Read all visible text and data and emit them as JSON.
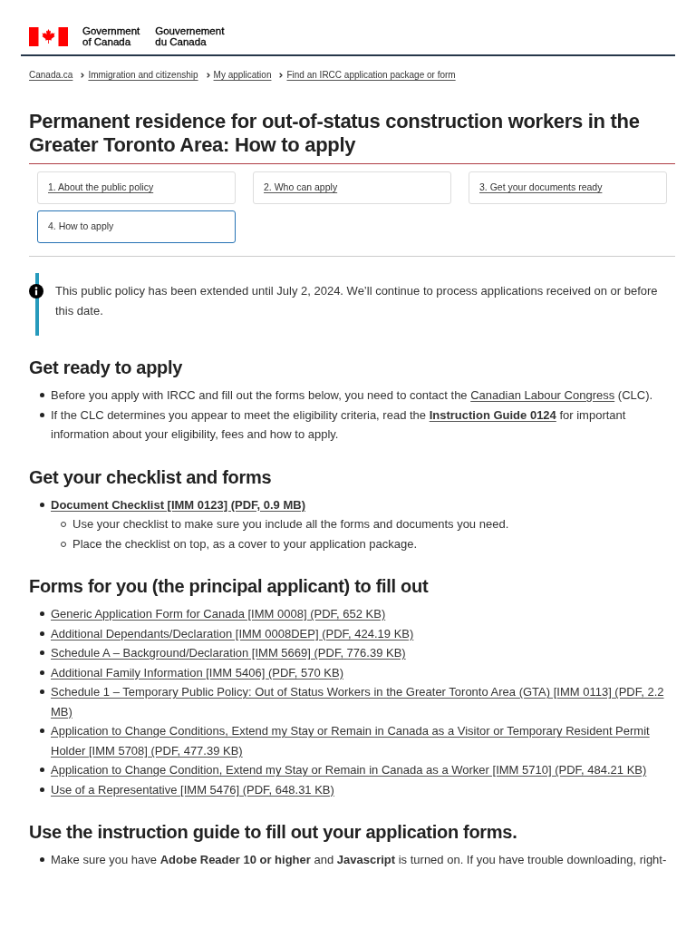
{
  "header": {
    "wordmark_en": [
      "Government",
      "of Canada"
    ],
    "wordmark_fr": [
      "Gouvernement",
      "du Canada"
    ]
  },
  "breadcrumbs": [
    "Canada.ca",
    "Immigration and citizenship",
    "My application",
    "Find an IRCC application package or form"
  ],
  "title": "Permanent residence for out-of-status construction workers in the Greater Toronto Area: How to apply",
  "steps": [
    {
      "label": "1. About the public policy",
      "selected": false
    },
    {
      "label": "2. Who can apply",
      "selected": false
    },
    {
      "label": "3. Get your documents ready",
      "selected": false
    },
    {
      "label": "4. How to apply",
      "selected": true
    }
  ],
  "notice": {
    "text": "This public policy has been extended until July 2, 2024. We’ll continue to process applications received on or before this date."
  },
  "sections": [
    {
      "heading": "Get ready to apply",
      "items": [
        {
          "kind": "paragraph",
          "parts": [
            {
              "kind": "text",
              "text": "Before you apply with IRCC and fill out the forms below, you need to contact the "
            },
            {
              "kind": "link",
              "text": "Canadian Labour Congress",
              "bold": false
            },
            {
              "kind": "text",
              "text": " (CLC)."
            }
          ]
        },
        {
          "kind": "paragraph",
          "parts": [
            {
              "kind": "text",
              "text": "If the CLC determines you appear to meet the eligibility criteria, read the "
            },
            {
              "kind": "link",
              "text": "Instruction Guide 0124",
              "bold": true
            },
            {
              "kind": "text",
              "text": " for important information about your eligibility, fees and how to apply."
            }
          ]
        }
      ]
    },
    {
      "heading": "Get your checklist and forms",
      "items": [
        {
          "kind": "link",
          "text": "Document Checklist [IMM 0123] (PDF, 0.9 MB)",
          "bold": true,
          "children": [
            {
              "kind": "paragraph",
              "parts": [
                {
                  "kind": "text",
                  "text": "Use your checklist to make sure you include all the forms and documents you need."
                }
              ]
            },
            {
              "kind": "paragraph",
              "parts": [
                {
                  "kind": "text",
                  "text": "Place the checklist on top, as a cover to your application package."
                }
              ]
            }
          ]
        }
      ]
    },
    {
      "heading": "Forms for you (the principal applicant) to fill out",
      "items": [
        {
          "kind": "link",
          "text": "Generic Application Form for Canada [IMM 0008] (PDF, 652 KB)",
          "bold": false
        },
        {
          "kind": "link",
          "text": "Additional Dependants/Declaration [IMM 0008DEP] (PDF, 424.19 KB)",
          "bold": false
        },
        {
          "kind": "link",
          "text": "Schedule A – Background/Declaration [IMM 5669] (PDF, 776.39 KB)",
          "bold": false
        },
        {
          "kind": "link",
          "text": "Additional Family Information [IMM 5406] (PDF, 570 KB)",
          "bold": false
        },
        {
          "kind": "link",
          "text": "Schedule 1 – Temporary Public Policy: Out of Status Workers in the Greater Toronto Area (GTA) [IMM 0113] (PDF, 2.2 MB)",
          "bold": false
        },
        {
          "kind": "link",
          "text": "Application to Change Conditions, Extend my Stay or Remain in Canada as a Visitor or Temporary Resident Permit Holder [IMM 5708] (PDF, 477.39 KB)",
          "bold": false
        },
        {
          "kind": "link",
          "text": "Application to Change Condition, Extend my Stay or Remain in Canada as a Worker [IMM 5710] (PDF, 484.21 KB)",
          "bold": false
        },
        {
          "kind": "link",
          "text": "Use of a Representative [IMM 5476] (PDF, 648.31 KB)",
          "bold": false
        }
      ]
    },
    {
      "heading": "Use the instruction guide to fill out your application forms.",
      "items": [
        {
          "kind": "paragraph",
          "parts": [
            {
              "kind": "text",
              "text": "Make sure you have **Adobe Reader 10 or higher** and **Javascript** is turned on. If you have trouble downloading, right-"
            }
          ]
        }
      ]
    }
  ]
}
